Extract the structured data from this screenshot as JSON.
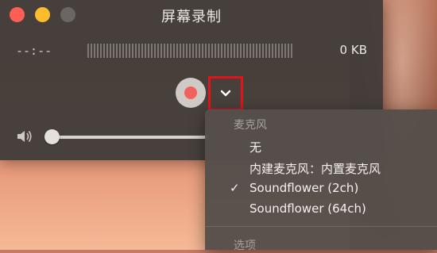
{
  "window": {
    "title": "屏幕录制",
    "timer": "--:--",
    "file_size": "0 KB"
  },
  "menu": {
    "section_microphone": "麦克风",
    "items": [
      {
        "label": "无",
        "checked": false
      },
      {
        "label": "内建麦克风：内置麦克风",
        "checked": false
      },
      {
        "label": "Soundflower (2ch)",
        "checked": true
      },
      {
        "label": "Soundflower (64ch)",
        "checked": false
      }
    ],
    "checkmark": "✓",
    "section_options": "选项"
  },
  "volume": {
    "level": 0.0
  },
  "colors": {
    "record": "#f0625a",
    "highlight_box": "#e0141a",
    "close": "#fd5f57",
    "minimize": "#fdbc2e"
  }
}
